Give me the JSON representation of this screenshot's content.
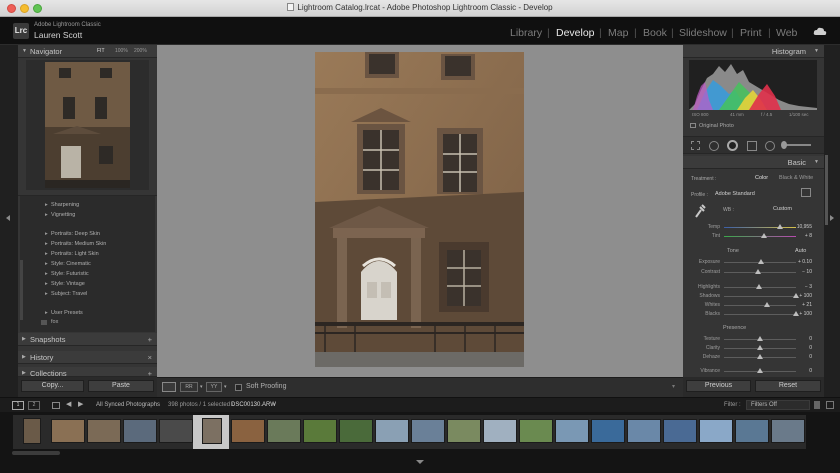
{
  "window": {
    "title": "Lightroom Catalog.lrcat - Adobe Photoshop Lightroom Classic - Develop"
  },
  "identity": {
    "badge": "Lrc",
    "app": "Adobe Lightroom Classic",
    "user": "Lauren Scott"
  },
  "modules": [
    {
      "label": "Library",
      "active": false
    },
    {
      "label": "Develop",
      "active": true
    },
    {
      "label": "Map",
      "active": false
    },
    {
      "label": "Book",
      "active": false
    },
    {
      "label": "Slideshow",
      "active": false
    },
    {
      "label": "Print",
      "active": false
    },
    {
      "label": "Web",
      "active": false
    }
  ],
  "navigator": {
    "title": "Navigator",
    "zoom": [
      "FIT",
      "100%",
      "200%"
    ]
  },
  "presets": {
    "items": [
      "Sharpening",
      "Vignetting",
      "Portraits: Deep Skin",
      "Portraits: Medium Skin",
      "Portraits: Light Skin",
      "Style: Cinematic",
      "Style: Futuristic",
      "Style: Vintage",
      "Subject: Travel",
      "User Presets"
    ],
    "user_item": "fox"
  },
  "left_sections": {
    "snapshots": "Snapshots",
    "history": "History",
    "collections": "Collections"
  },
  "left_buttons": {
    "copy": "Copy...",
    "paste": "Paste"
  },
  "toolbar": {
    "soft_proofing": "Soft Proofing"
  },
  "histogram": {
    "title": "Histogram",
    "iso": "ISO 800",
    "focal": "41 mm",
    "aperture": "f / 4.5",
    "shutter": "1/100 sec",
    "original": "Original Photo"
  },
  "basic": {
    "title": "Basic",
    "treatment_label": "Treatment :",
    "treatment_color": "Color",
    "treatment_bw": "Black & White",
    "profile_label": "Profile :",
    "profile_value": "Adobe Standard",
    "wb_label": "WB :",
    "wb_value": "Custom",
    "tone_label": "Tone",
    "tone_auto": "Auto",
    "presence_label": "Presence"
  },
  "sliders": [
    {
      "label": "Temp",
      "value": "10,955",
      "pos": 0.78
    },
    {
      "label": "Tint",
      "value": "+ 8",
      "pos": 0.55
    },
    {
      "label": "Exposure",
      "value": "+ 0.10",
      "pos": 0.52
    },
    {
      "label": "Contrast",
      "value": "− 10",
      "pos": 0.47
    },
    {
      "label": "Highlights",
      "value": "− 3",
      "pos": 0.49
    },
    {
      "label": "Shadows",
      "value": "+ 100",
      "pos": 1.0
    },
    {
      "label": "Whites",
      "value": "+ 21",
      "pos": 0.6
    },
    {
      "label": "Blacks",
      "value": "+ 100",
      "pos": 1.0
    },
    {
      "label": "Texture",
      "value": "0",
      "pos": 0.5
    },
    {
      "label": "Clarity",
      "value": "0",
      "pos": 0.5
    },
    {
      "label": "Dehaze",
      "value": "0",
      "pos": 0.5
    },
    {
      "label": "Vibrance",
      "value": "0",
      "pos": 0.5
    }
  ],
  "right_buttons": {
    "previous": "Previous",
    "reset": "Reset"
  },
  "filmstrip": {
    "source": "All Synced Photographs",
    "count": "398 photos / 1 selected /",
    "filename": "DSC00130.ARW",
    "filter_label": "Filter :",
    "filter_value": "Filters Off",
    "thumb_colors": [
      "#6a5a48",
      "#8a7054",
      "#7b6a56",
      "#5b6a7c",
      "#4a4a4a",
      "#7c7062",
      "#8a6240",
      "#6a7a5a",
      "#5a7a3a",
      "#4a6a3a",
      "#8aa0b4",
      "#6a8098",
      "#7a8a60",
      "#a0b0c0",
      "#6a8a50",
      "#7a98b4",
      "#3a6a9a",
      "#6a88a8",
      "#4a6a94",
      "#8aa8c8",
      "#5a7894",
      "#6a7a8a",
      "#5a6878",
      "#8a9aa8"
    ]
  }
}
